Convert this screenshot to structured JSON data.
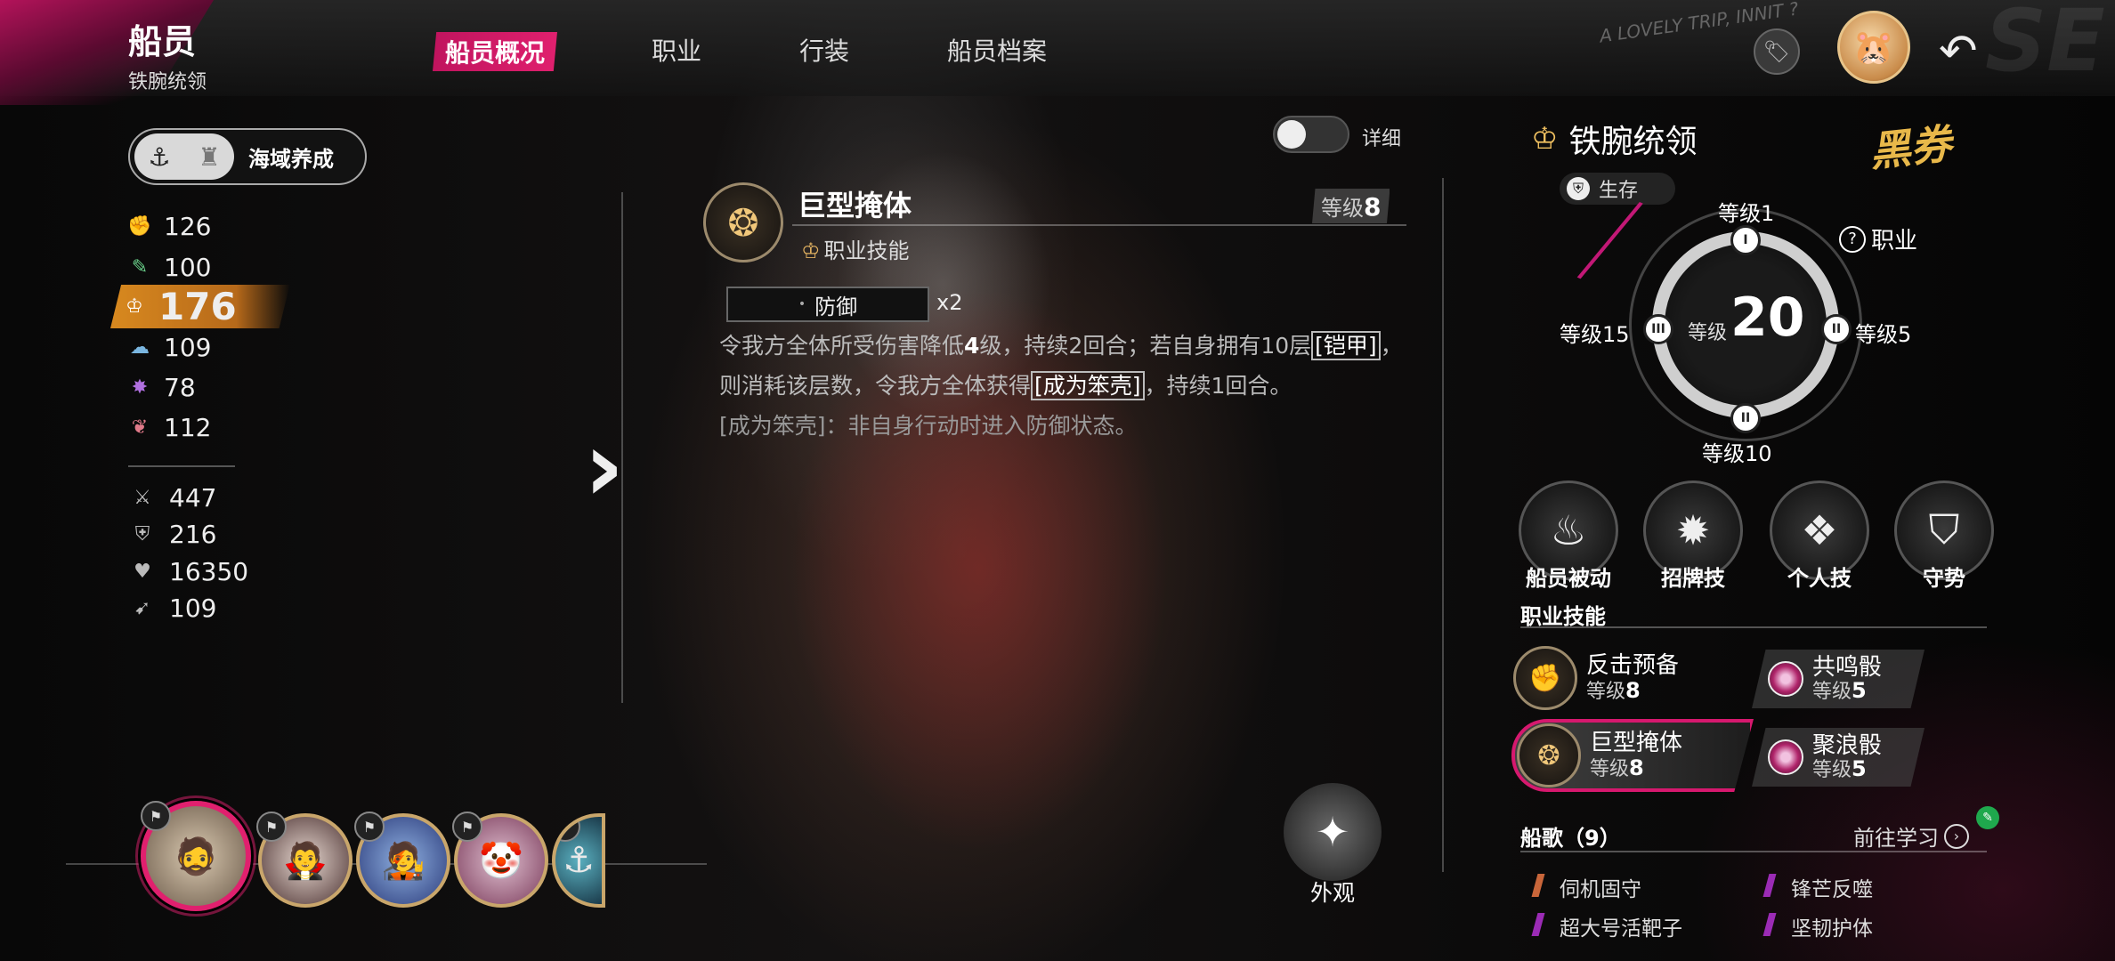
{
  "header": {
    "title": "船员",
    "subtitle": "铁腕统领",
    "tabs": [
      {
        "label": "船员概况",
        "active": true
      },
      {
        "label": "职业",
        "active": false
      },
      {
        "label": "行装",
        "active": false
      },
      {
        "label": "船员档案",
        "active": false
      }
    ],
    "corner_text": "A LOVELY TRIP, INNIT ?",
    "bg_letters": "SE",
    "icons": {
      "tag": "tag-icon",
      "avatar": "hamster-avatar-icon",
      "back": "back-arrow-icon"
    }
  },
  "sea_button": {
    "label": "海域养成",
    "icons": [
      "anchor-icon",
      "tower-icon"
    ]
  },
  "stats": [
    {
      "icon": "fist-icon",
      "value": "126",
      "color": "#e07a6a"
    },
    {
      "icon": "green-arm-icon",
      "value": "100",
      "color": "#6ad08a"
    },
    {
      "icon": "class-emblem-icon",
      "value": "176",
      "highlight": true,
      "color": "#d8891f"
    },
    {
      "icon": "cloud-icon",
      "value": "109",
      "color": "#7ab6e0"
    },
    {
      "icon": "star-burst-icon",
      "value": "78",
      "color": "#b070e0"
    },
    {
      "icon": "lips-icon",
      "value": "112",
      "color": "#e07a8a"
    }
  ],
  "stats2": [
    {
      "icon": "sword-icon",
      "value": "447"
    },
    {
      "icon": "shield-icon",
      "value": "216"
    },
    {
      "icon": "heart-icon",
      "value": "16350"
    },
    {
      "icon": "boot-icon",
      "value": "109"
    }
  ],
  "detail_toggle": {
    "label": "详细",
    "on": false
  },
  "skill_detail": {
    "name": "巨型掩体",
    "type": "职业技能",
    "level_label": "等级",
    "level": "8",
    "badge": "防御",
    "multiplier": "x2",
    "desc_parts": [
      "令我方全体所受伤害降低",
      "4",
      "级，持续2回合；若自身拥有10层",
      "[铠甲]",
      "，则消耗该层数，令我方全体获得",
      "[成为笨壳]",
      "，持续1回合。"
    ],
    "note": "[成为笨壳]：非自身行动时进入防御状态。"
  },
  "outfit_button": {
    "label": "外观"
  },
  "roster": [
    {
      "name": "crew-1",
      "emoji": "🧔",
      "selected": true
    },
    {
      "name": "crew-2",
      "emoji": "🧛"
    },
    {
      "name": "crew-3",
      "emoji": "🧑‍🎤"
    },
    {
      "name": "crew-4",
      "emoji": "🤡"
    },
    {
      "name": "crew-5",
      "emoji": "⚓"
    }
  ],
  "class_panel": {
    "name": "铁腕统领",
    "brand": "黑券",
    "tag": "生存",
    "help": "职业",
    "center_label": "等级",
    "center_value": "20",
    "nodes": [
      {
        "label": "等级1",
        "roman": "I"
      },
      {
        "label": "等级5",
        "roman": "II"
      },
      {
        "label": "等级10",
        "roman": "II"
      },
      {
        "label": "等级15",
        "roman": "III"
      }
    ]
  },
  "abilities": [
    {
      "label": "船员被动",
      "icon": "flame-wing-icon"
    },
    {
      "label": "招牌技",
      "icon": "burst-icon"
    },
    {
      "label": "个人技",
      "icon": "crystal-icon"
    },
    {
      "label": "守势",
      "icon": "guard-icon"
    }
  ],
  "class_skills": {
    "title": "职业技能",
    "items": [
      {
        "name": "反击预备",
        "level_label": "等级",
        "level": "8",
        "active": false
      },
      {
        "name": "巨型掩体",
        "level_label": "等级",
        "level": "8",
        "active": true
      }
    ],
    "dice": [
      {
        "name": "共鸣骰",
        "level_label": "等级",
        "level": "5"
      },
      {
        "name": "聚浪骰",
        "level_label": "等级",
        "level": "5"
      }
    ]
  },
  "songs": {
    "title": "船歌（9）",
    "goto": "前往学习",
    "items": [
      {
        "name": "伺机固守",
        "color": "#c9663a"
      },
      {
        "name": "锋芒反噬",
        "color": "#9b2bb5"
      },
      {
        "name": "超大号活靶子",
        "color": "#9b2bb5"
      },
      {
        "name": "坚韧护体",
        "color": "#9b2bb5"
      }
    ]
  }
}
